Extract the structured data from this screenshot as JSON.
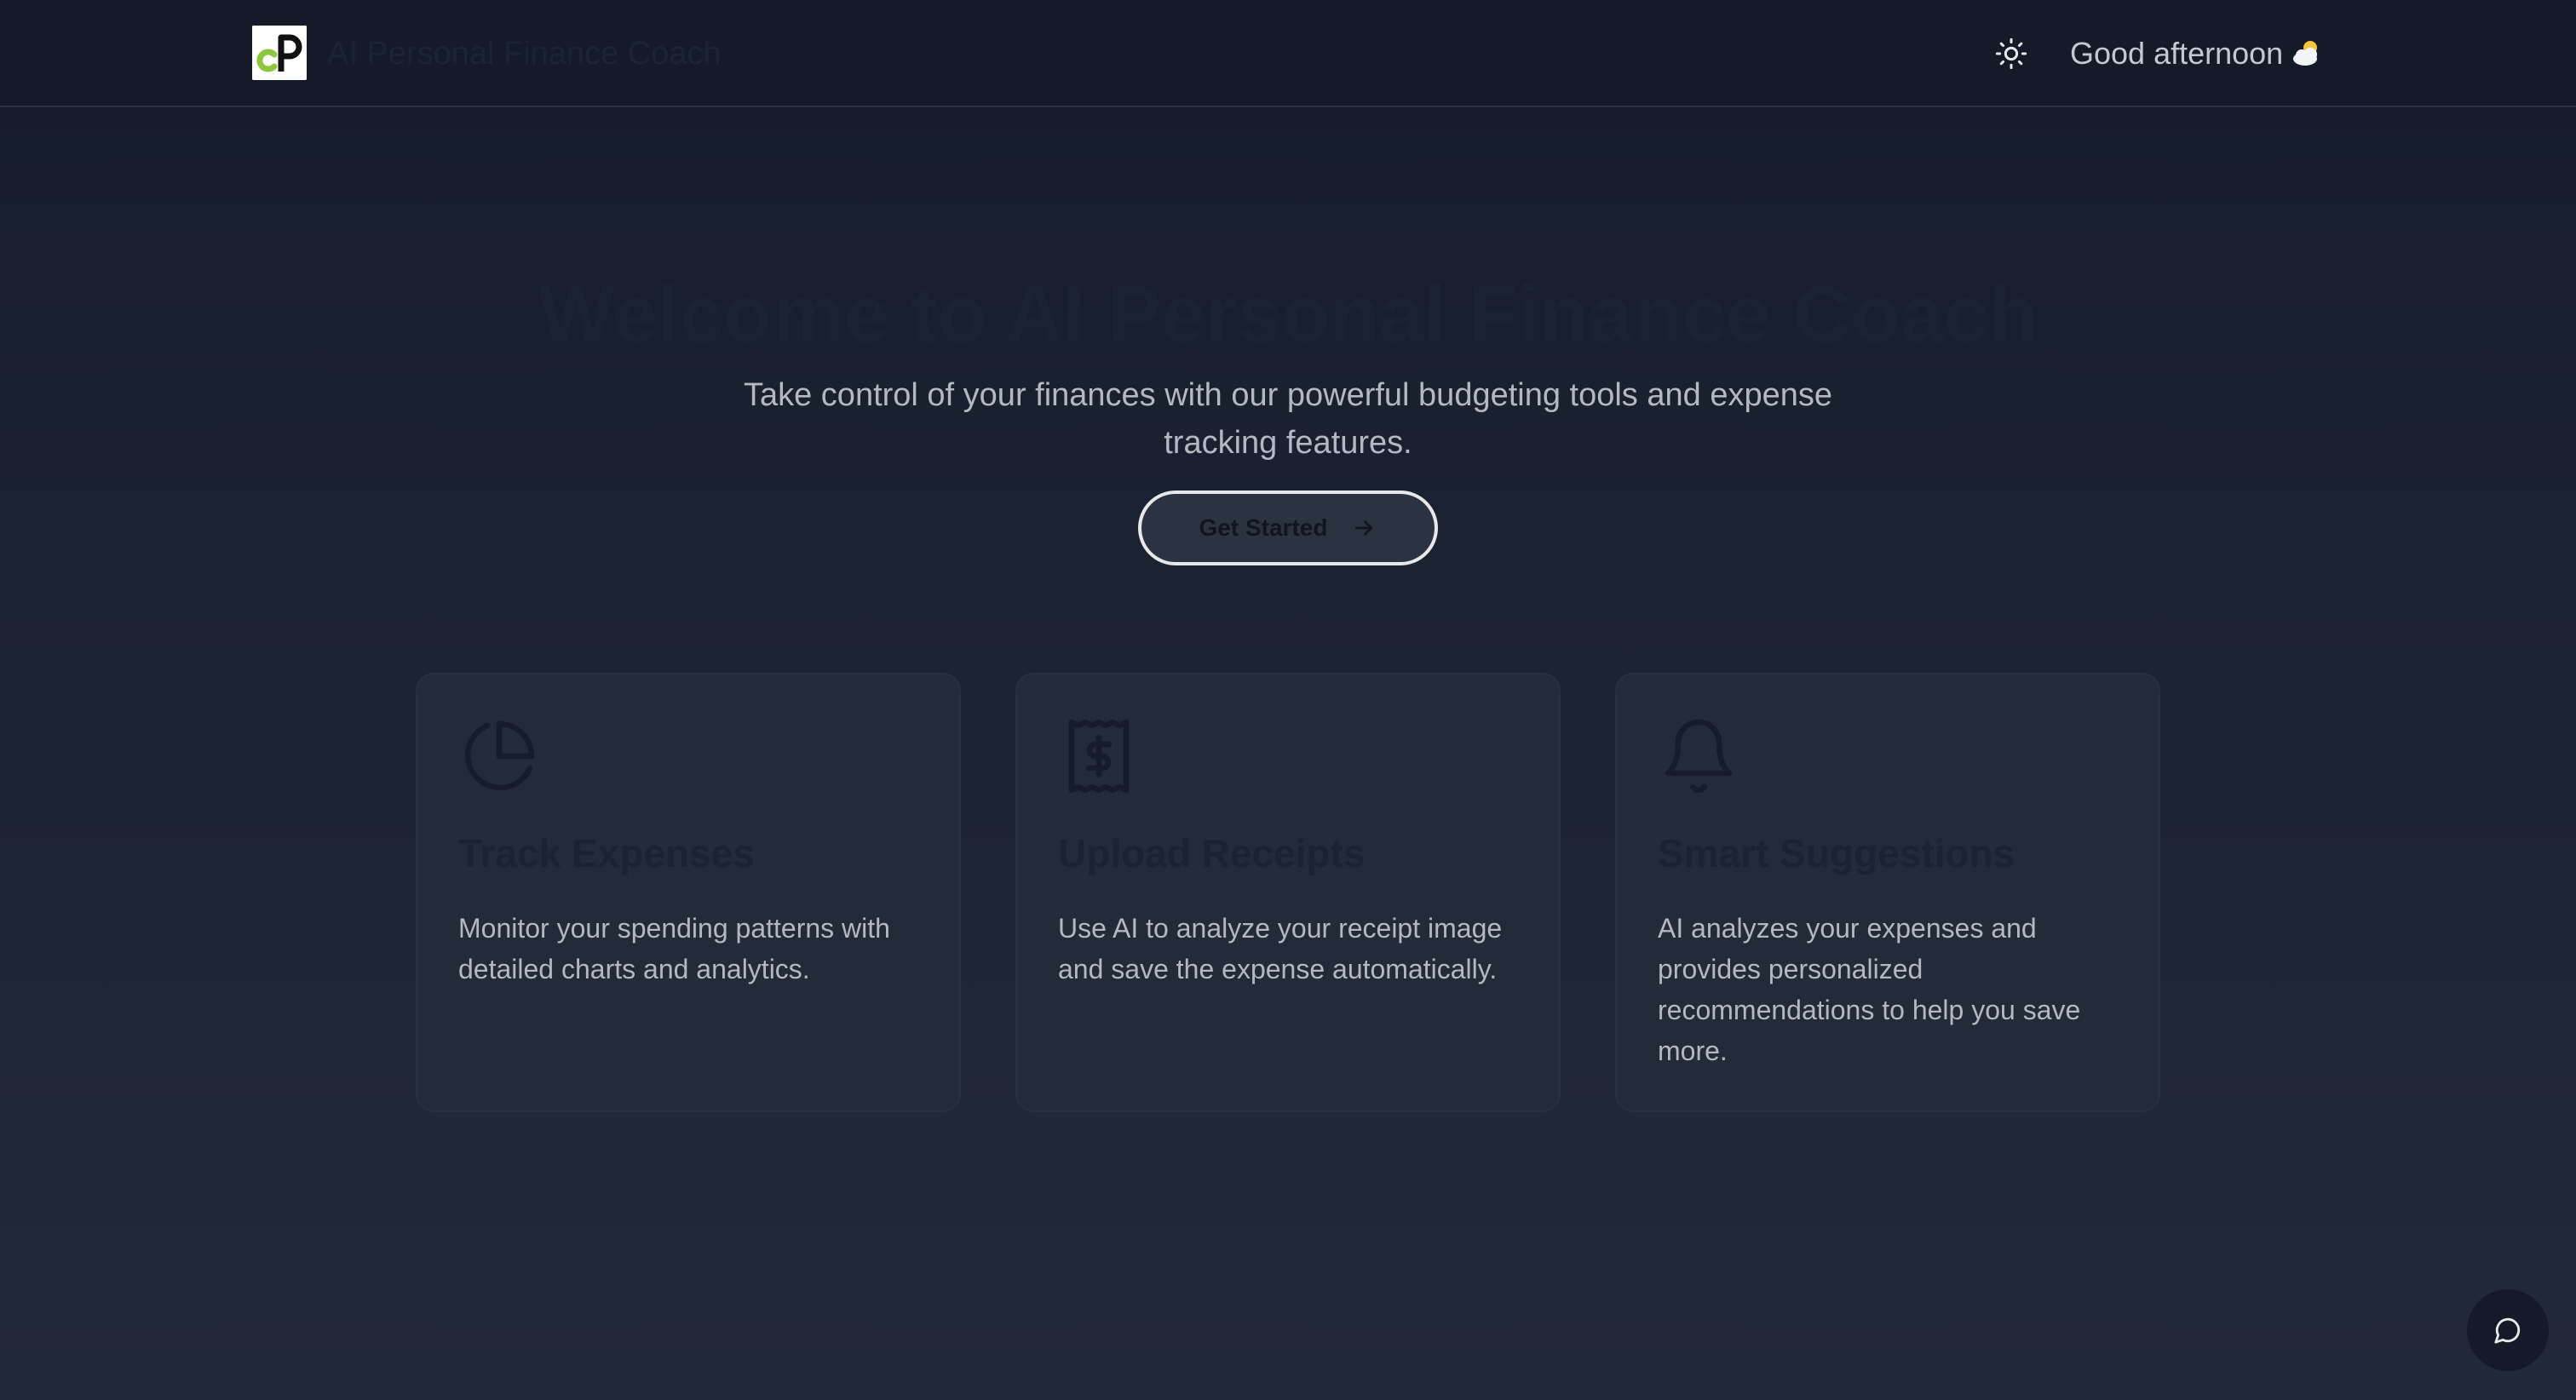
{
  "header": {
    "brand_name": "AI Personal Finance Coach",
    "greeting": "Good afternoon",
    "weather_icon": "sun-behind-cloud-icon",
    "theme_toggle_icon": "sun-icon"
  },
  "hero": {
    "title": "Welcome to AI Personal Finance Coach",
    "subtitle": "Take control of your finances with our powerful budgeting tools and expense tracking features.",
    "cta_label": "Get Started",
    "cta_icon": "arrow-right-icon"
  },
  "features": [
    {
      "icon": "pie-chart-icon",
      "title": "Track Expenses",
      "description": "Monitor your spending patterns with detailed charts and analytics."
    },
    {
      "icon": "receipt-dollar-icon",
      "title": "Upload Receipts",
      "description": "Use AI to analyze your receipt image and save the expense automatically."
    },
    {
      "icon": "bell-icon",
      "title": "Smart Suggestions",
      "description": "AI analyzes your expenses and provides personalized recommendations to help you save more."
    }
  ],
  "chat": {
    "icon": "chat-bubble-icon"
  },
  "colors": {
    "background": "#1d2433",
    "header_background": "#141a27",
    "card_background": "#232a38",
    "logo_green": "#8dc63f",
    "text_muted": "#b3b8c2"
  }
}
